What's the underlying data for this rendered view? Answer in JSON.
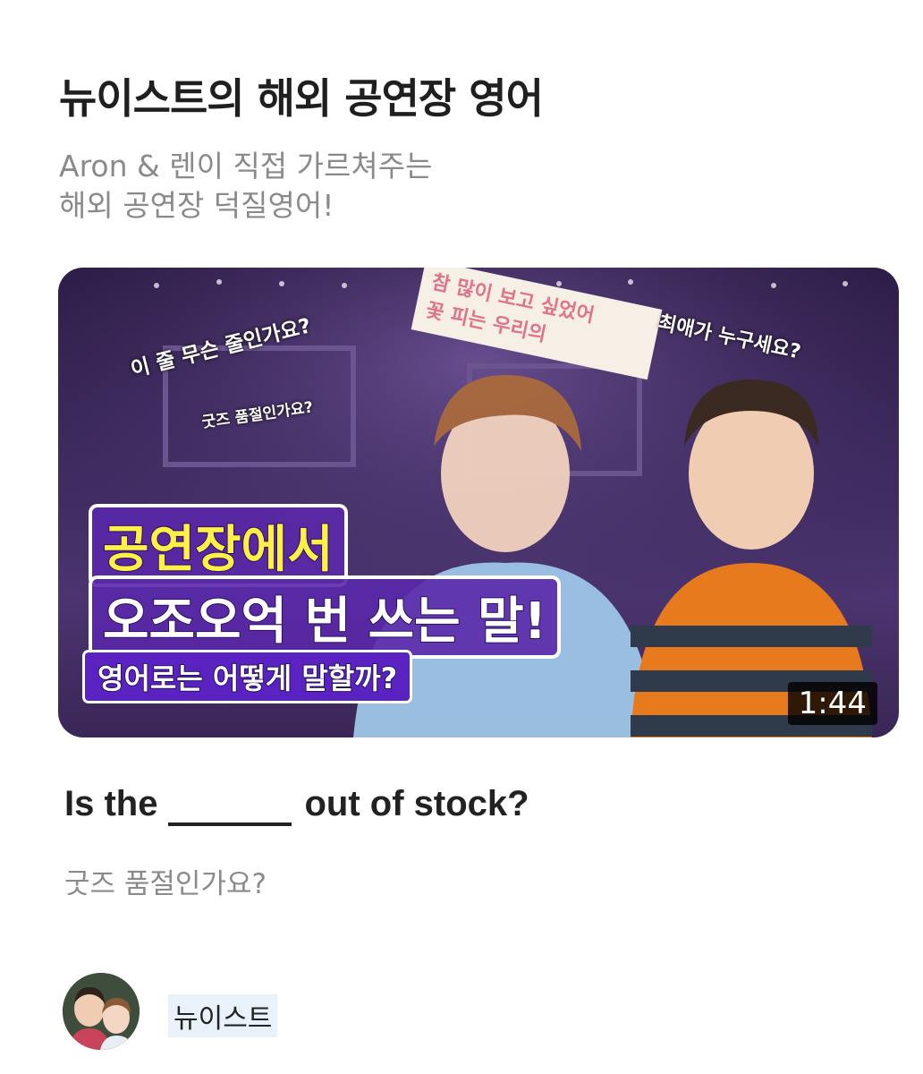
{
  "header": {
    "title": "뉴이스트의 해외 공연장 영어",
    "subtitle_lines": [
      "Aron & 렌이 직접 가르쳐주는",
      "해외 공연장 덕질영어!"
    ]
  },
  "video": {
    "duration": "1:44",
    "overlay": {
      "bubble1": "이 줄 무슨 줄인가요?",
      "bubble2": "굿즈 품절인가요?",
      "bubble3": "최애가 누구세요?",
      "banner_line1": "참 많이 보고 싶었어",
      "banner_line2": "꽃 피는 우리의",
      "headline1": "공연장에서",
      "headline2": "오조오억 번 쓰는 말!",
      "headline3": "영어로는 어떻게 말할까?"
    }
  },
  "quiz": {
    "question_before": "Is the",
    "question_after": "out of stock?",
    "answer": "굿즈 품절인가요?"
  },
  "channel": {
    "name": "뉴이스트",
    "avatar_icon": "channel-avatar"
  },
  "colors": {
    "title": "#1f1f1f",
    "subtitle": "#8a8a8a",
    "headline_yellow": "#fff046",
    "headline_purple": "#5a22c0",
    "name_highlight": "#e9f1fb"
  }
}
